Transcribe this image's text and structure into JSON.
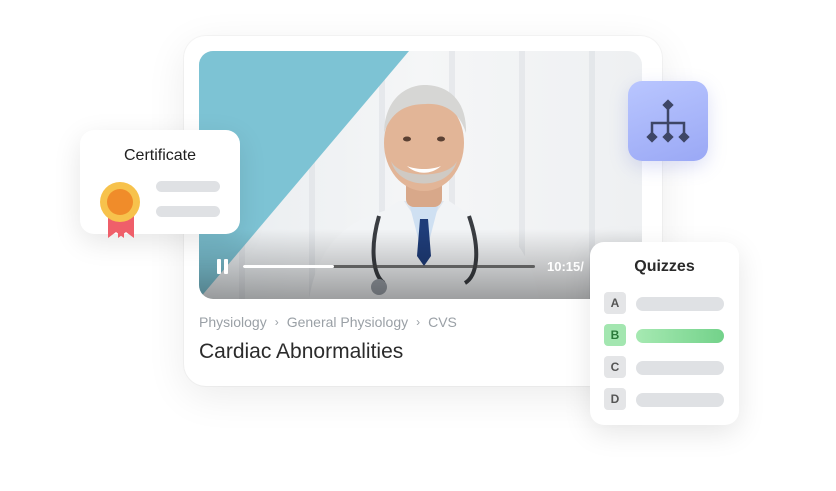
{
  "video": {
    "progress": 0.31,
    "time_label": "10:15/"
  },
  "breadcrumb": [
    "Physiology",
    "General Physiology",
    "CVS"
  ],
  "breadcrumb_separator": "›",
  "course_title": "Cardiac Abnormalities",
  "certificate": {
    "title": "Certificate",
    "icon": "award-ribbon-icon"
  },
  "hierarchy_tile": {
    "icon": "hierarchy-icon",
    "color": "#a9b6fb"
  },
  "quizzes": {
    "title": "Quizzes",
    "options": [
      {
        "letter": "A",
        "selected": false
      },
      {
        "letter": "B",
        "selected": true
      },
      {
        "letter": "C",
        "selected": false
      },
      {
        "letter": "D",
        "selected": false
      }
    ]
  },
  "colors": {
    "accent_teal": "#7dc3d4",
    "quiz_selected": "#73d28a",
    "medal_orange": "#f39c2b",
    "ribbon_red": "#ef5f6a"
  }
}
